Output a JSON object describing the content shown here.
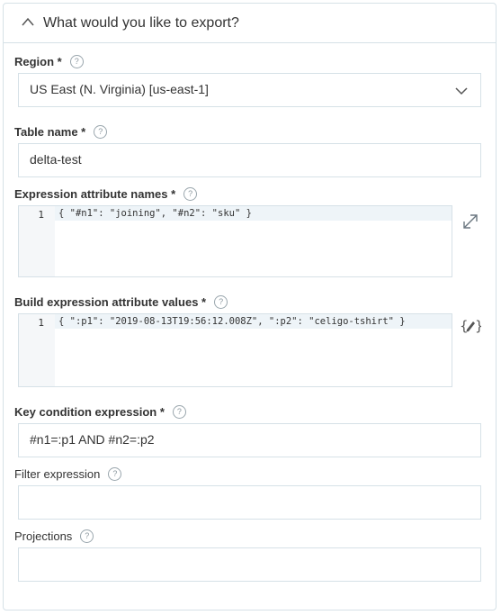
{
  "panel": {
    "title": "What would you like to export?"
  },
  "region": {
    "label": "Region *",
    "value": "US East (N. Virginia) [us-east-1]"
  },
  "table_name": {
    "label": "Table name *",
    "value": "delta-test"
  },
  "expr_names": {
    "label": "Expression attribute names *",
    "line_number": "1",
    "code": "{ \"#n1\": \"joining\", \"#n2\": \"sku\" }"
  },
  "expr_values": {
    "label": "Build expression attribute values *",
    "line_number": "1",
    "code": "{ \":p1\": \"2019-08-13T19:56:12.008Z\", \":p2\": \"celigo-tshirt\" }"
  },
  "key_condition": {
    "label": "Key condition expression *",
    "value": "#n1=:p1 AND #n2=:p2"
  },
  "filter_expression": {
    "label": "Filter expression",
    "value": ""
  },
  "projections": {
    "label": "Projections",
    "value": ""
  },
  "help_glyph": "?"
}
